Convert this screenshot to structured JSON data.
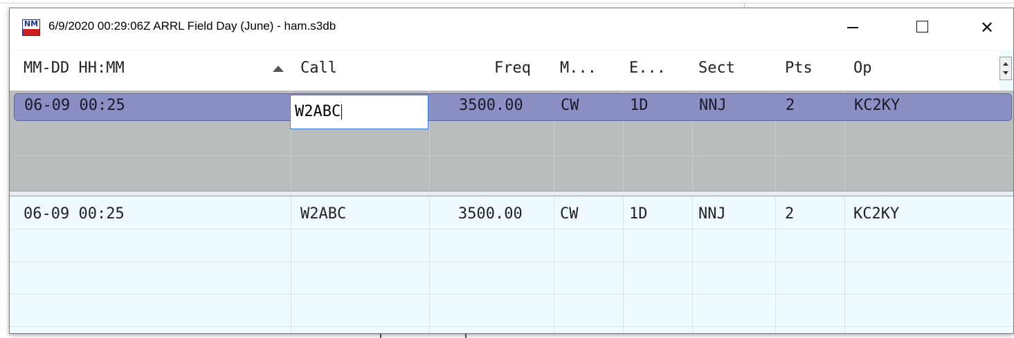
{
  "window": {
    "title": "6/9/2020 00:29:06Z  ARRL Field Day (June) - ham.s3db",
    "icon_name": "app-logo-icon",
    "icon_text_top": "NM",
    "minimize_icon": "minimize-icon",
    "maximize_icon": "maximize-icon",
    "close_icon": "close-icon",
    "close_label": "✕"
  },
  "columns": [
    {
      "key": "datetime",
      "label": "MM-DD HH:MM"
    },
    {
      "key": "call",
      "label": "Call",
      "sorted": "ascending"
    },
    {
      "key": "freq",
      "label": "Freq"
    },
    {
      "key": "mode",
      "label": "M..."
    },
    {
      "key": "exch",
      "label": "E..."
    },
    {
      "key": "sect",
      "label": "Sect"
    },
    {
      "key": "pts",
      "label": "Pts"
    },
    {
      "key": "op",
      "label": "Op"
    }
  ],
  "edit_row": {
    "datetime": "06-09 00:25",
    "call": "W2ABC",
    "freq": "3500.00",
    "mode": "CW",
    "exch": "1D",
    "sect": "NNJ",
    "pts": "2",
    "op": "KC2KY"
  },
  "log_rows": [
    {
      "datetime": "06-09 00:25",
      "call": "W2ABC",
      "freq": "3500.00",
      "mode": "CW",
      "exch": "1D",
      "sect": "NNJ",
      "pts": "2",
      "op": "KC2KY"
    }
  ],
  "colors": {
    "selected_row": "#8b8fc4",
    "edit_pane_bg": "#b9bdbe",
    "log_pane_bg": "#eefaff",
    "edit_border": "#3b7be0"
  }
}
